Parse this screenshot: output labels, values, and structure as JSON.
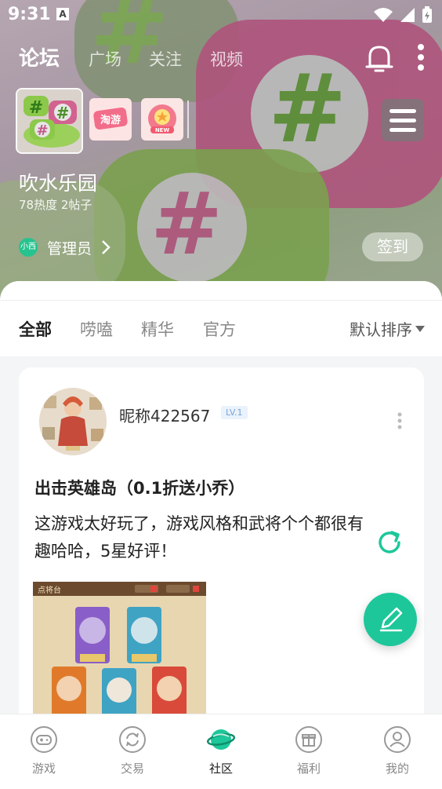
{
  "status_bar": {
    "time": "9:31",
    "badge": "A"
  },
  "top_nav": {
    "tabs": [
      {
        "label": "论坛",
        "active": true
      },
      {
        "label": "广场",
        "active": false
      },
      {
        "label": "关注",
        "active": false
      },
      {
        "label": "视频",
        "active": false
      }
    ]
  },
  "forum": {
    "small_icons": [
      "淘游",
      "NEW"
    ],
    "title": "吹水乐园",
    "stats": "78热度  2帖子",
    "admin_avatar_text": "小西",
    "admin_label": "管理员",
    "signin_label": "签到"
  },
  "filters": {
    "tabs": [
      {
        "label": "全部",
        "active": true
      },
      {
        "label": "唠嗑",
        "active": false
      },
      {
        "label": "精华",
        "active": false
      },
      {
        "label": "官方",
        "active": false
      }
    ],
    "sort_label": "默认排序"
  },
  "post": {
    "nickname": "昵称422567",
    "level": "LV.1",
    "title": "出击英雄岛（0.1折送小乔）",
    "body": "这游戏太好玩了，游戏风格和武将个个都很有趣哈哈，5星好评！",
    "image_caption": "点将台"
  },
  "bottom_nav": {
    "items": [
      {
        "label": "游戏",
        "icon": "gamepad-icon",
        "active": false
      },
      {
        "label": "交易",
        "icon": "exchange-icon",
        "active": false
      },
      {
        "label": "社区",
        "icon": "planet-icon",
        "active": true
      },
      {
        "label": "福利",
        "icon": "gift-icon",
        "active": false
      },
      {
        "label": "我的",
        "icon": "user-icon",
        "active": false
      }
    ]
  },
  "colors": {
    "accent": "#1dc79a",
    "hero_pink": "#c25a88",
    "hero_green": "#7cbb4b"
  }
}
